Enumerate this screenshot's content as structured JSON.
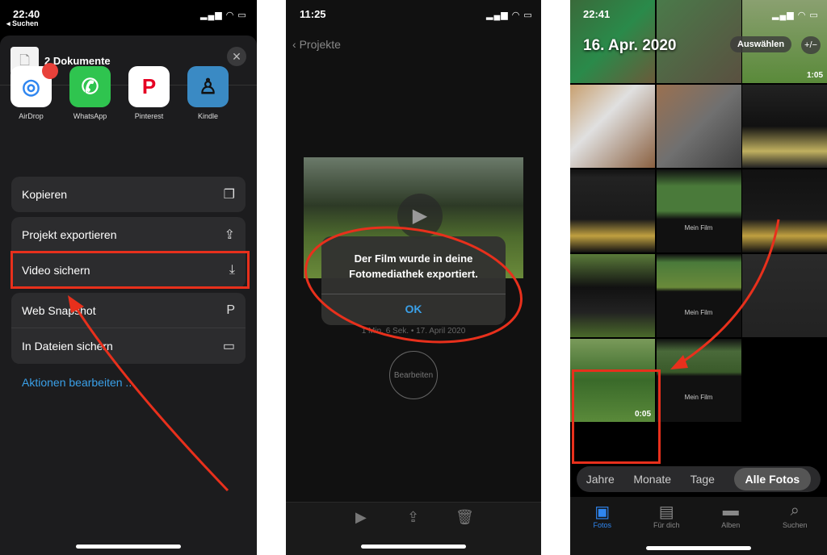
{
  "panel1": {
    "time": "22:40",
    "back": "◂ Suchen",
    "sheet_title": "2 Dokumente",
    "apps": [
      {
        "label": "AirDrop",
        "color": "#ffffff",
        "glyph": "◎",
        "fg": "#2f86f0"
      },
      {
        "label": "WhatsApp",
        "color": "#2fc44f",
        "glyph": "✆",
        "fg": "#ffffff"
      },
      {
        "label": "Pinterest",
        "color": "#ffffff",
        "glyph": "P",
        "fg": "#e60023"
      },
      {
        "label": "Kindle",
        "color": "#3a8ac4",
        "glyph": "♙",
        "fg": "#111111"
      }
    ],
    "group1": [
      {
        "label": "Kopieren",
        "icon": "copy-icon",
        "glyph": "❐"
      }
    ],
    "group2": [
      {
        "label": "Projekt exportieren",
        "icon": "share-icon",
        "glyph": "⇪"
      },
      {
        "label": "Video sichern",
        "icon": "download-icon",
        "glyph": "⤓"
      }
    ],
    "group3": [
      {
        "label": "Web Snapshot",
        "icon": "snapshot-icon",
        "glyph": "P"
      },
      {
        "label": "In Dateien sichern",
        "icon": "folder-icon",
        "glyph": "▭"
      }
    ],
    "edit_actions": "Aktionen bearbeiten ..."
  },
  "panel2": {
    "time": "11:25",
    "back": "Projekte",
    "alert_line1": "Der Film wurde in deine",
    "alert_line2": "Fotomediathek exportiert.",
    "ok": "OK",
    "meta": "1 Min. 6 Sek. • 17. April 2020",
    "edit": "Bearbeiten"
  },
  "panel3": {
    "time": "22:41",
    "date": "16. Apr. 2020",
    "select": "Auswählen",
    "plusminus": "+/−",
    "tiles": [
      {
        "bg": "linear-gradient(135deg,#3a6a3a,#2a8a4a 50%,#6a5a3a)"
      },
      {
        "bg": "linear-gradient(135deg,#4a7a4a,#5a5040)"
      },
      {
        "bg": "linear-gradient(#8aa070,#5a8a3a)",
        "dur": "1:05"
      },
      {
        "bg": "linear-gradient(135deg,#c8a070,#e0e0e0 40%,#8a6040)"
      },
      {
        "bg": "linear-gradient(135deg,#9a7050,#707070 50%,#404040)"
      },
      {
        "bg": "linear-gradient(#222,#111 50%,#c0b060 80%,#222)"
      },
      {
        "bg": "linear-gradient(#111,#222 10%,#1a1a1a 60%,#c0a040 80%,#111)"
      },
      {
        "bg": "linear-gradient(#111,#4a7a3a 20%,#4a7a3a 50%,#111 60%)",
        "title": "Mein Film"
      },
      {
        "bg": "linear-gradient(#111,#1a1a1a 60%,#c0a040 80%,#111)"
      },
      {
        "bg": "linear-gradient(#5a7a3a,#111 40%,#222 70%,#4a6a2a)"
      },
      {
        "bg": "linear-gradient(#111,#4a7a3a 10%,#6a8a3a 40%,#111 45%)",
        "title": "Mein Film"
      },
      {
        "bg": "linear-gradient(#2a2a2a,#222)"
      },
      {
        "bg": "linear-gradient(#7a9a5a,#3a6a2a 50%,#5a8a3a)",
        "dur": "0:05"
      },
      {
        "bg": "linear-gradient(#111,#4a6a3a 15%,#3a5a2a 40%,#111 45%)",
        "title": "Mein Film"
      },
      {
        "bg": "#000"
      }
    ],
    "segments": [
      "Jahre",
      "Monate",
      "Tage",
      "Alle Fotos"
    ],
    "tabs": [
      {
        "label": "Fotos",
        "glyph": "▣"
      },
      {
        "label": "Für dich",
        "glyph": "▤"
      },
      {
        "label": "Alben",
        "glyph": "▬"
      },
      {
        "label": "Suchen",
        "glyph": "⌕"
      }
    ]
  },
  "colors": {
    "highlight": "#e8301c",
    "accent": "#3aa0e8"
  }
}
